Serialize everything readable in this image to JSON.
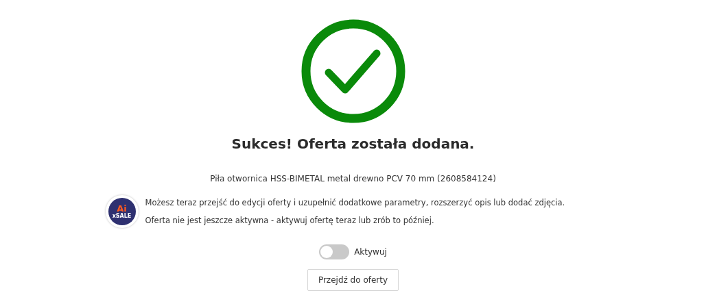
{
  "title": "Sukces! Oferta została dodana.",
  "product": "Piła otwornica HSS-BIMETAL metal drewno PCV 70 mm (2608584124)",
  "assistant": {
    "logo_mark": "Ai",
    "logo_caption": "xSALE",
    "messages": [
      "Możesz teraz przejść do edycji oferty i uzupełnić dodatkowe parametry, rozszerzyć opis lub dodać zdjęcia.",
      "Oferta nie jest jeszcze aktywna - aktywuj ofertę teraz lub zrób to później."
    ]
  },
  "toggle": {
    "label": "Aktywuj",
    "on": false
  },
  "button": "Przejdź do oferty"
}
